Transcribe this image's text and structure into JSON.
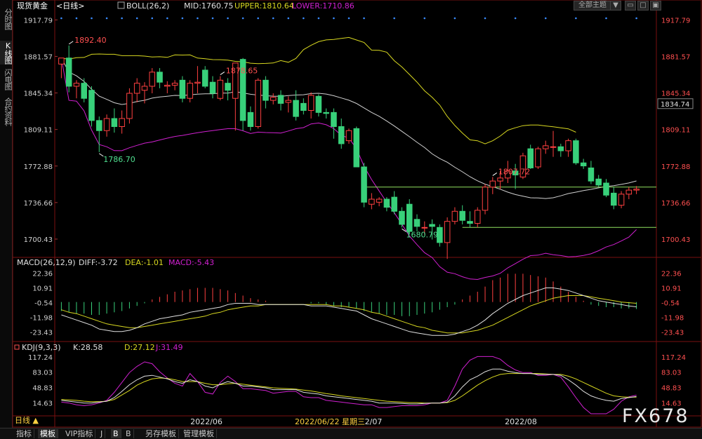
{
  "side_tabs": [
    {
      "label": "分时图",
      "active": false
    },
    {
      "label": "K线图",
      "active": true
    },
    {
      "label": "闪电图",
      "active": false
    },
    {
      "label": "合约资料",
      "active": false
    }
  ],
  "header": {
    "instrument": "现货黄金",
    "period": "<日线>",
    "indicator": "BOLL(26,2)",
    "mid": "MID:1760.75",
    "upper": "UPPER:1810.64",
    "lower": "LOWER:1710.86",
    "theme_button": "全部主题",
    "theme_arrow": "▼"
  },
  "macd_header": {
    "name": "MACD(26,12,9)",
    "diff": "DIFF:-3.72",
    "dea": "DEA:-1.01",
    "macd": "MACD:-5.43"
  },
  "kdj_header": {
    "name": "KDJ(9,3,3)",
    "k": "K:28.58",
    "d": "D:27.12",
    "j": "J:31.49"
  },
  "current_price_label": "1834.74",
  "bottom_tabs": [
    {
      "label": "指标",
      "active": false
    },
    {
      "label": "模板",
      "active": true
    },
    {
      "label": "VIP指标",
      "active": false
    },
    {
      "label": "J",
      "active": false
    },
    {
      "label": "B",
      "active": true
    },
    {
      "label": "B",
      "active": false
    },
    {
      "label": "另存模板",
      "active": false
    },
    {
      "label": "管理模板",
      "active": false
    }
  ],
  "period_label": "日线 ▲",
  "watermark": "FX678",
  "colors": {
    "up": "#ff4040",
    "down": "#38d07a",
    "mid": "#d0d0d0",
    "upper": "#d8d820",
    "lower": "#d020d0",
    "support": "#90e060",
    "macd_diff": "#e0e0e0",
    "macd_dea": "#d8d820",
    "kdj_k": "#e0e0e0",
    "kdj_d": "#d8d820",
    "kdj_j": "#d020d0"
  },
  "chart_data": [
    {
      "type": "candlestick",
      "panel": "main",
      "y_ticks": [
        "1917.79",
        "1881.57",
        "1845.34",
        "1809.11",
        "1772.88",
        "1736.66",
        "1700.43"
      ],
      "ylim": [
        1683,
        1925
      ],
      "x_ticks": [
        "2022/06",
        "2022/06/22 星期三",
        "2/07",
        "2022/08"
      ],
      "annotations": [
        {
          "text": "1892.40",
          "bar": 1,
          "kind": "high"
        },
        {
          "text": "1878.65",
          "bar": 21,
          "kind": "high"
        },
        {
          "text": "1786.70",
          "bar": 5,
          "kind": "low"
        },
        {
          "text": "1680.79",
          "bar": 45,
          "kind": "low"
        },
        {
          "text": "1807.72",
          "bar": 57,
          "kind": "high"
        }
      ],
      "candles": [
        {
          "o": 1874,
          "h": 1880,
          "l": 1860,
          "c": 1880
        },
        {
          "o": 1880,
          "h": 1892.4,
          "l": 1846,
          "c": 1852
        },
        {
          "o": 1852,
          "h": 1858,
          "l": 1840,
          "c": 1855
        },
        {
          "o": 1855,
          "h": 1860,
          "l": 1836,
          "c": 1840
        },
        {
          "o": 1848,
          "h": 1852,
          "l": 1812,
          "c": 1818
        },
        {
          "o": 1818,
          "h": 1822,
          "l": 1786.7,
          "c": 1808
        },
        {
          "o": 1808,
          "h": 1824,
          "l": 1802,
          "c": 1820
        },
        {
          "o": 1820,
          "h": 1830,
          "l": 1806,
          "c": 1812
        },
        {
          "o": 1812,
          "h": 1828,
          "l": 1805,
          "c": 1820
        },
        {
          "o": 1820,
          "h": 1850,
          "l": 1815,
          "c": 1845
        },
        {
          "o": 1845,
          "h": 1860,
          "l": 1836,
          "c": 1855
        },
        {
          "o": 1848,
          "h": 1856,
          "l": 1835,
          "c": 1852
        },
        {
          "o": 1852,
          "h": 1870,
          "l": 1845,
          "c": 1866
        },
        {
          "o": 1866,
          "h": 1870,
          "l": 1850,
          "c": 1856
        },
        {
          "o": 1852,
          "h": 1857,
          "l": 1845,
          "c": 1853
        },
        {
          "o": 1853,
          "h": 1858,
          "l": 1848,
          "c": 1855
        },
        {
          "o": 1858,
          "h": 1862,
          "l": 1836,
          "c": 1840
        },
        {
          "o": 1840,
          "h": 1858,
          "l": 1836,
          "c": 1855
        },
        {
          "o": 1855,
          "h": 1872,
          "l": 1845,
          "c": 1856
        },
        {
          "o": 1868,
          "h": 1872,
          "l": 1850,
          "c": 1852
        },
        {
          "o": 1856,
          "h": 1862,
          "l": 1840,
          "c": 1845
        },
        {
          "o": 1840,
          "h": 1862,
          "l": 1838,
          "c": 1858
        },
        {
          "o": 1855,
          "h": 1860,
          "l": 1838,
          "c": 1848
        },
        {
          "o": 1840,
          "h": 1872,
          "l": 1808,
          "c": 1875
        },
        {
          "o": 1878.65,
          "h": 1880,
          "l": 1808,
          "c": 1818
        },
        {
          "o": 1826,
          "h": 1832,
          "l": 1808,
          "c": 1812
        },
        {
          "o": 1812,
          "h": 1860,
          "l": 1810,
          "c": 1858
        },
        {
          "o": 1858,
          "h": 1862,
          "l": 1830,
          "c": 1838
        },
        {
          "o": 1838,
          "h": 1845,
          "l": 1834,
          "c": 1841
        },
        {
          "o": 1843,
          "h": 1848,
          "l": 1828,
          "c": 1835
        },
        {
          "o": 1836,
          "h": 1842,
          "l": 1826,
          "c": 1838
        },
        {
          "o": 1838,
          "h": 1848,
          "l": 1818,
          "c": 1822
        },
        {
          "o": 1835,
          "h": 1840,
          "l": 1824,
          "c": 1828
        },
        {
          "o": 1828,
          "h": 1846,
          "l": 1820,
          "c": 1843
        },
        {
          "o": 1842,
          "h": 1844,
          "l": 1822,
          "c": 1826
        },
        {
          "o": 1826,
          "h": 1830,
          "l": 1820,
          "c": 1825
        },
        {
          "o": 1826,
          "h": 1830,
          "l": 1800,
          "c": 1812
        },
        {
          "o": 1812,
          "h": 1820,
          "l": 1790,
          "c": 1795
        },
        {
          "o": 1798,
          "h": 1810,
          "l": 1795,
          "c": 1808
        },
        {
          "o": 1810,
          "h": 1812,
          "l": 1780,
          "c": 1772
        },
        {
          "o": 1772,
          "h": 1776,
          "l": 1732,
          "c": 1737
        },
        {
          "o": 1735,
          "h": 1746,
          "l": 1730,
          "c": 1740
        },
        {
          "o": 1737,
          "h": 1742,
          "l": 1733,
          "c": 1740
        },
        {
          "o": 1740,
          "h": 1742,
          "l": 1728,
          "c": 1732
        },
        {
          "o": 1742,
          "h": 1748,
          "l": 1725,
          "c": 1728
        },
        {
          "o": 1728,
          "h": 1732,
          "l": 1712,
          "c": 1715
        },
        {
          "o": 1735,
          "h": 1740,
          "l": 1705,
          "c": 1708
        },
        {
          "o": 1720,
          "h": 1725,
          "l": 1708,
          "c": 1713
        },
        {
          "o": 1712,
          "h": 1718,
          "l": 1705,
          "c": 1712
        },
        {
          "o": 1715,
          "h": 1720,
          "l": 1700,
          "c": 1713
        },
        {
          "o": 1712,
          "h": 1715,
          "l": 1693,
          "c": 1697
        },
        {
          "o": 1697,
          "h": 1722,
          "l": 1680.79,
          "c": 1718
        },
        {
          "o": 1718,
          "h": 1732,
          "l": 1715,
          "c": 1728
        },
        {
          "o": 1728,
          "h": 1734,
          "l": 1715,
          "c": 1719
        },
        {
          "o": 1718,
          "h": 1728,
          "l": 1712,
          "c": 1716
        },
        {
          "o": 1716,
          "h": 1732,
          "l": 1712,
          "c": 1729
        },
        {
          "o": 1729,
          "h": 1755,
          "l": 1725,
          "c": 1752
        },
        {
          "o": 1752,
          "h": 1762,
          "l": 1745,
          "c": 1758
        },
        {
          "o": 1758,
          "h": 1768,
          "l": 1750,
          "c": 1761
        },
        {
          "o": 1761,
          "h": 1778,
          "l": 1756,
          "c": 1768
        },
        {
          "o": 1768,
          "h": 1775,
          "l": 1750,
          "c": 1764
        },
        {
          "o": 1762,
          "h": 1786,
          "l": 1760,
          "c": 1783
        },
        {
          "o": 1790,
          "h": 1794,
          "l": 1770,
          "c": 1771
        },
        {
          "o": 1772,
          "h": 1792,
          "l": 1770,
          "c": 1790
        },
        {
          "o": 1790,
          "h": 1798,
          "l": 1785,
          "c": 1793
        },
        {
          "o": 1792,
          "h": 1807.72,
          "l": 1782,
          "c": 1792
        },
        {
          "o": 1792,
          "h": 1795,
          "l": 1782,
          "c": 1788
        },
        {
          "o": 1788,
          "h": 1800,
          "l": 1782,
          "c": 1798
        },
        {
          "o": 1798,
          "h": 1800,
          "l": 1774,
          "c": 1776
        },
        {
          "o": 1776,
          "h": 1780,
          "l": 1770,
          "c": 1773
        },
        {
          "o": 1771,
          "h": 1778,
          "l": 1755,
          "c": 1758
        },
        {
          "o": 1760,
          "h": 1764,
          "l": 1752,
          "c": 1754
        },
        {
          "o": 1756,
          "h": 1760,
          "l": 1742,
          "c": 1744
        },
        {
          "o": 1746,
          "h": 1752,
          "l": 1730,
          "c": 1734
        },
        {
          "o": 1734,
          "h": 1748,
          "l": 1731,
          "c": 1745
        },
        {
          "o": 1745,
          "h": 1752,
          "l": 1740,
          "c": 1749
        },
        {
          "o": 1749,
          "h": 1753,
          "l": 1745,
          "c": 1750
        }
      ]
    },
    {
      "type": "line",
      "panel": "macd",
      "y_ticks": [
        "22.36",
        "10.91",
        "-0.54",
        "-11.98",
        "-23.43"
      ],
      "ylim": [
        -28,
        26
      ],
      "series": [
        {
          "name": "DIFF",
          "values": [
            -10,
            -12,
            -14,
            -16,
            -18,
            -21,
            -22,
            -23,
            -23,
            -22,
            -20,
            -17,
            -15,
            -13,
            -12,
            -11,
            -10,
            -8,
            -7,
            -6,
            -5,
            -4,
            -2,
            -1,
            -1,
            -1,
            -2,
            -2,
            -2,
            -2,
            -2,
            -2,
            -2,
            -3,
            -3,
            -3,
            -4,
            -5,
            -6,
            -7,
            -10,
            -13,
            -15,
            -17,
            -19,
            -21,
            -23,
            -24,
            -25,
            -26,
            -26,
            -26,
            -25,
            -23,
            -21,
            -18,
            -14,
            -9,
            -5,
            -1,
            2,
            5,
            7,
            9,
            11,
            11,
            10,
            9,
            7,
            5,
            3,
            1,
            0,
            -1,
            -2,
            -3,
            -3.72
          ]
        },
        {
          "name": "DEA",
          "values": [
            -6,
            -8,
            -9,
            -11,
            -13,
            -15,
            -17,
            -18,
            -19,
            -20,
            -20,
            -19,
            -18,
            -17,
            -16,
            -15,
            -14,
            -13,
            -12,
            -11,
            -9,
            -8,
            -6,
            -5,
            -4,
            -3,
            -3,
            -2,
            -2,
            -2,
            -2,
            -2,
            -2,
            -2,
            -2,
            -2,
            -3,
            -3,
            -4,
            -5,
            -6,
            -8,
            -9,
            -11,
            -13,
            -15,
            -17,
            -19,
            -20,
            -22,
            -23,
            -24,
            -24,
            -24,
            -23,
            -22,
            -20,
            -18,
            -15,
            -12,
            -9,
            -6,
            -3,
            -1,
            1,
            3,
            4,
            5,
            5,
            5,
            4,
            3,
            2,
            1,
            0,
            -0.5,
            -1.01
          ]
        },
        {
          "name": "MACD",
          "values": [
            -7,
            -8,
            -9,
            -9,
            -10,
            -10,
            -9,
            -8,
            -7,
            -5,
            -3,
            -1,
            2,
            4,
            6,
            8,
            9,
            10,
            11,
            11,
            11,
            10,
            9,
            7,
            5,
            3,
            2,
            1,
            0,
            0,
            0,
            0,
            0,
            -1,
            -1,
            -2,
            -3,
            -4,
            -4,
            -5,
            -7,
            -8,
            -9,
            -10,
            -10,
            -11,
            -11,
            -10,
            -9,
            -8,
            -6,
            -4,
            -2,
            2,
            5,
            8,
            12,
            17,
            19,
            22,
            22,
            22,
            21,
            20,
            19,
            16,
            12,
            8,
            4,
            1,
            -2,
            -3,
            -4,
            -4,
            -5,
            -5,
            -5.43
          ]
        }
      ]
    },
    {
      "type": "line",
      "panel": "kdj",
      "y_ticks": [
        "117.24",
        "83.03",
        "48.83",
        "14.63"
      ],
      "ylim": [
        -10,
        128
      ],
      "series": [
        {
          "name": "K",
          "values": [
            20,
            18,
            16,
            14,
            14,
            16,
            18,
            26,
            40,
            55,
            66,
            74,
            76,
            72,
            68,
            62,
            58,
            66,
            62,
            52,
            48,
            56,
            62,
            58,
            52,
            52,
            50,
            48,
            44,
            44,
            44,
            44,
            38,
            36,
            34,
            30,
            28,
            26,
            24,
            22,
            20,
            18,
            14,
            14,
            14,
            13,
            12,
            12,
            13,
            14,
            14,
            16,
            30,
            50,
            66,
            74,
            84,
            90,
            90,
            85,
            82,
            80,
            80,
            78,
            78,
            78,
            76,
            66,
            54,
            40,
            30,
            24,
            20,
            18,
            24,
            26,
            28.58
          ]
        },
        {
          "name": "D",
          "values": [
            22,
            21,
            20,
            18,
            17,
            17,
            18,
            22,
            32,
            42,
            54,
            62,
            68,
            70,
            69,
            66,
            62,
            62,
            62,
            58,
            55,
            55,
            57,
            58,
            56,
            54,
            52,
            50,
            48,
            47,
            46,
            45,
            43,
            41,
            38,
            35,
            33,
            30,
            28,
            26,
            24,
            22,
            20,
            18,
            17,
            16,
            15,
            15,
            14,
            14,
            14,
            15,
            20,
            30,
            42,
            54,
            64,
            72,
            78,
            80,
            80,
            80,
            80,
            80,
            79,
            78,
            78,
            74,
            68,
            60,
            52,
            44,
            36,
            30,
            28,
            27,
            27.12
          ]
        },
        {
          "name": "J",
          "values": [
            16,
            14,
            10,
            8,
            10,
            14,
            20,
            38,
            60,
            82,
            96,
            106,
            102,
            84,
            70,
            58,
            52,
            80,
            62,
            38,
            34,
            60,
            74,
            62,
            46,
            46,
            44,
            42,
            36,
            38,
            40,
            40,
            28,
            26,
            26,
            20,
            18,
            16,
            14,
            12,
            10,
            10,
            4,
            4,
            6,
            8,
            8,
            8,
            10,
            14,
            14,
            20,
            52,
            90,
            110,
            118,
            118,
            118,
            112,
            98,
            88,
            82,
            82,
            76,
            76,
            78,
            72,
            50,
            26,
            4,
            -10,
            -10,
            -10,
            0,
            18,
            28,
            31.49
          ]
        }
      ]
    }
  ]
}
